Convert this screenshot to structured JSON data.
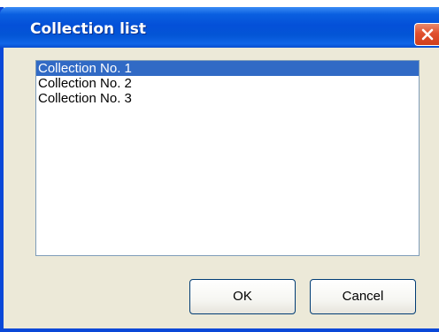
{
  "dialog": {
    "title": "Collection list",
    "close_icon": "close-icon",
    "accent_color": "#0a5fe0",
    "selection_color": "#316ac5"
  },
  "list": {
    "items": [
      {
        "label": "Collection No. 1",
        "selected": true
      },
      {
        "label": "Collection No. 2",
        "selected": false
      },
      {
        "label": "Collection No. 3",
        "selected": false
      }
    ]
  },
  "buttons": {
    "ok_label": "OK",
    "cancel_label": "Cancel"
  }
}
